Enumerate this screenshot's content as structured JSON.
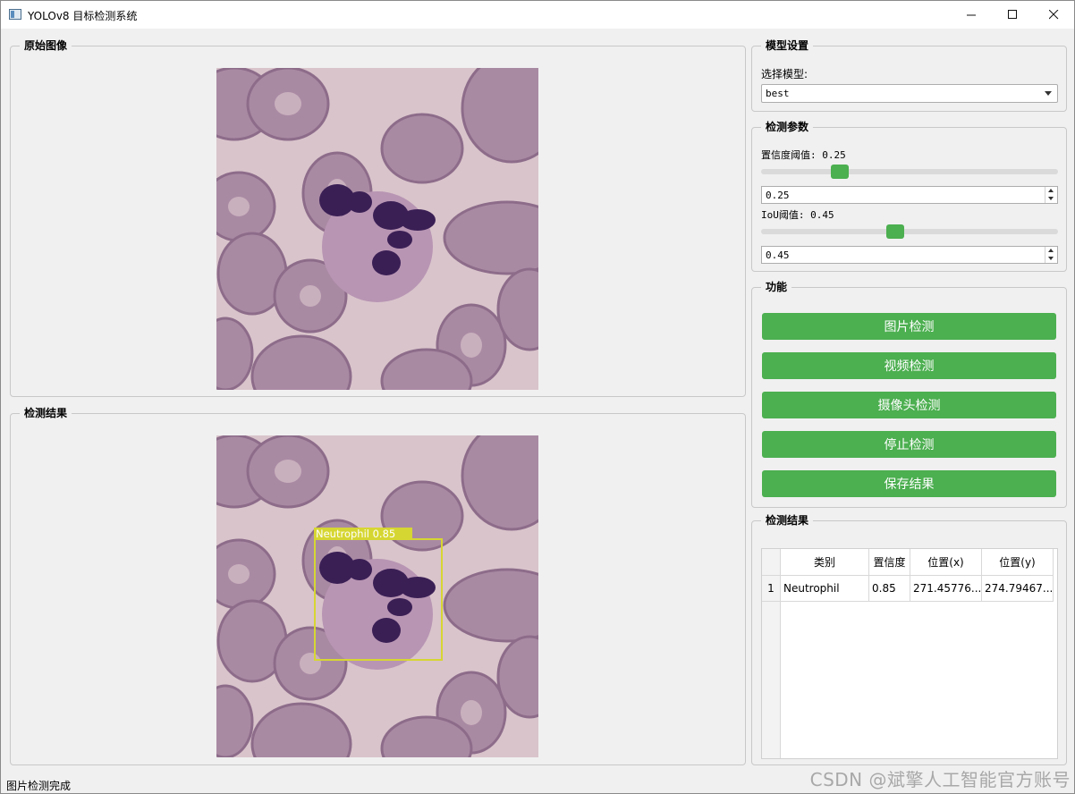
{
  "window": {
    "title": "YOLOv8 目标检测系统",
    "minimize_icon": "minimize-icon",
    "maximize_icon": "maximize-icon",
    "close_icon": "close-icon"
  },
  "original_panel": {
    "title": "原始图像"
  },
  "result_panel": {
    "title": "检测结果",
    "detection_label": "Neutrophil 0.85",
    "box_color": "#d6d632"
  },
  "model_settings": {
    "title": "模型设置",
    "select_label": "选择模型:",
    "selected_model": "best"
  },
  "detection_params": {
    "title": "检测参数",
    "conf_label": "置信度阈值: 0.25",
    "conf_value": "0.25",
    "conf_level": 0.25,
    "iou_label": "IoU阈值: 0.45",
    "iou_value": "0.45",
    "iou_level": 0.45
  },
  "functions": {
    "title": "功能",
    "buttons": [
      "图片检测",
      "视频检测",
      "摄像头检测",
      "停止检测",
      "保存结果"
    ],
    "button_color": "#4caf50"
  },
  "results_table": {
    "title": "检测结果",
    "headers": [
      "类别",
      "置信度",
      "位置(x)",
      "位置(y)"
    ],
    "rows": [
      {
        "index": "1",
        "class": "Neutrophil",
        "confidence": "0.85",
        "x": "271.45776...",
        "y": "274.79467..."
      }
    ]
  },
  "status_bar": {
    "text": "图片检测完成"
  },
  "watermark": {
    "text": "CSDN @斌擎人工智能官方账号"
  }
}
